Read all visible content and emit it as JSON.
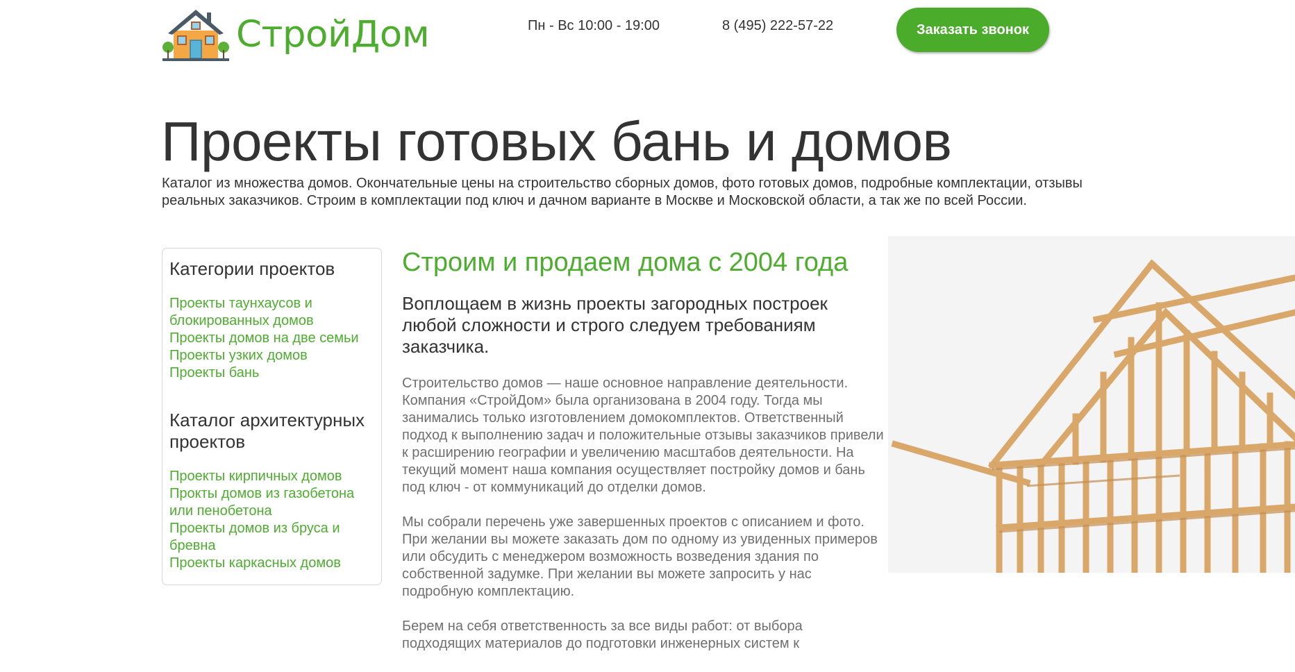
{
  "header": {
    "logo_text": "СтройДом",
    "hours": "Пн - Вс 10:00 - 19:00",
    "phone": "8 (495) 222-57-22",
    "callback_label": "Заказать звонок"
  },
  "page": {
    "title": "Проекты готовых бань и домов",
    "lead": "Каталог из множества домов. Окончательные цены на строительство сборных домов, фото готовых домов, подробные комплектации, отзывы реальных заказчиков. Строим в комплектации под ключ и дачном варианте в Москве и Московской области, а так же по всей России."
  },
  "sidebar": {
    "group1_title": "Категории проектов",
    "group1_items": [
      "Проекты таунхаусов и блокированных домов",
      "Проекты домов на две семьи",
      "Проекты узких домов",
      "Проекты бань"
    ],
    "group2_title": "Каталог архитектурных проектов",
    "group2_items": [
      "Проекты кирпичных домов",
      "Прокты домов из газобетона или пенобетона",
      "Проекты домов из бруса и бревна",
      "Проекты каркасных домов"
    ]
  },
  "main": {
    "heading": "Строим и продаем дома с 2004 года",
    "subheading": "Воплощаем в жизнь проекты загородных построек любой сложности и строго следуем требованиям заказчика.",
    "paragraphs": [
      "Строительство домов — наше основное направление деятельности. Компания «СтройДом» была организована в 2004 году. Тогда мы занимались только изготовлением домокомплектов. Ответственный подход к выполнению задач и положительные отзывы заказчиков привели к расширению географии и увеличению масштабов деятельности. На текущий момент наша компания осуществляет постройку домов и бань под ключ - от коммуникаций до отделки домов.",
      "Мы собрали перечень уже завершенных проектов с описанием и фото. При желании вы можете заказать дом по одному из увиденных примеров или обсудить с менеджером возможность возведения здания по собственной задумке. При желании вы можете запросить у нас подробную комплектацию.",
      "Берем на себя ответственность за все виды работ: от выбора подходящих материалов до подготовки инженерных систем к"
    ]
  },
  "colors": {
    "brand_green": "#4dad2e",
    "button_green": "#4bab2a",
    "text_dark": "#333333",
    "text_gray": "#6f6f6f"
  }
}
